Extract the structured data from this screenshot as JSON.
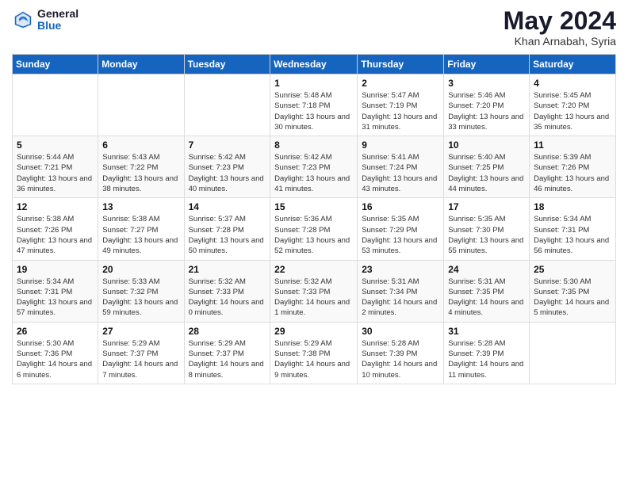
{
  "header": {
    "logo_general": "General",
    "logo_blue": "Blue",
    "title": "May 2024",
    "location": "Khan Arnabah, Syria"
  },
  "days_of_week": [
    "Sunday",
    "Monday",
    "Tuesday",
    "Wednesday",
    "Thursday",
    "Friday",
    "Saturday"
  ],
  "weeks": [
    [
      {
        "day": "",
        "info": ""
      },
      {
        "day": "",
        "info": ""
      },
      {
        "day": "",
        "info": ""
      },
      {
        "day": "1",
        "info": "Sunrise: 5:48 AM\nSunset: 7:18 PM\nDaylight: 13 hours\nand 30 minutes."
      },
      {
        "day": "2",
        "info": "Sunrise: 5:47 AM\nSunset: 7:19 PM\nDaylight: 13 hours\nand 31 minutes."
      },
      {
        "day": "3",
        "info": "Sunrise: 5:46 AM\nSunset: 7:20 PM\nDaylight: 13 hours\nand 33 minutes."
      },
      {
        "day": "4",
        "info": "Sunrise: 5:45 AM\nSunset: 7:20 PM\nDaylight: 13 hours\nand 35 minutes."
      }
    ],
    [
      {
        "day": "5",
        "info": "Sunrise: 5:44 AM\nSunset: 7:21 PM\nDaylight: 13 hours\nand 36 minutes."
      },
      {
        "day": "6",
        "info": "Sunrise: 5:43 AM\nSunset: 7:22 PM\nDaylight: 13 hours\nand 38 minutes."
      },
      {
        "day": "7",
        "info": "Sunrise: 5:42 AM\nSunset: 7:23 PM\nDaylight: 13 hours\nand 40 minutes."
      },
      {
        "day": "8",
        "info": "Sunrise: 5:42 AM\nSunset: 7:23 PM\nDaylight: 13 hours\nand 41 minutes."
      },
      {
        "day": "9",
        "info": "Sunrise: 5:41 AM\nSunset: 7:24 PM\nDaylight: 13 hours\nand 43 minutes."
      },
      {
        "day": "10",
        "info": "Sunrise: 5:40 AM\nSunset: 7:25 PM\nDaylight: 13 hours\nand 44 minutes."
      },
      {
        "day": "11",
        "info": "Sunrise: 5:39 AM\nSunset: 7:26 PM\nDaylight: 13 hours\nand 46 minutes."
      }
    ],
    [
      {
        "day": "12",
        "info": "Sunrise: 5:38 AM\nSunset: 7:26 PM\nDaylight: 13 hours\nand 47 minutes."
      },
      {
        "day": "13",
        "info": "Sunrise: 5:38 AM\nSunset: 7:27 PM\nDaylight: 13 hours\nand 49 minutes."
      },
      {
        "day": "14",
        "info": "Sunrise: 5:37 AM\nSunset: 7:28 PM\nDaylight: 13 hours\nand 50 minutes."
      },
      {
        "day": "15",
        "info": "Sunrise: 5:36 AM\nSunset: 7:28 PM\nDaylight: 13 hours\nand 52 minutes."
      },
      {
        "day": "16",
        "info": "Sunrise: 5:35 AM\nSunset: 7:29 PM\nDaylight: 13 hours\nand 53 minutes."
      },
      {
        "day": "17",
        "info": "Sunrise: 5:35 AM\nSunset: 7:30 PM\nDaylight: 13 hours\nand 55 minutes."
      },
      {
        "day": "18",
        "info": "Sunrise: 5:34 AM\nSunset: 7:31 PM\nDaylight: 13 hours\nand 56 minutes."
      }
    ],
    [
      {
        "day": "19",
        "info": "Sunrise: 5:34 AM\nSunset: 7:31 PM\nDaylight: 13 hours\nand 57 minutes."
      },
      {
        "day": "20",
        "info": "Sunrise: 5:33 AM\nSunset: 7:32 PM\nDaylight: 13 hours\nand 59 minutes."
      },
      {
        "day": "21",
        "info": "Sunrise: 5:32 AM\nSunset: 7:33 PM\nDaylight: 14 hours\nand 0 minutes."
      },
      {
        "day": "22",
        "info": "Sunrise: 5:32 AM\nSunset: 7:33 PM\nDaylight: 14 hours\nand 1 minute."
      },
      {
        "day": "23",
        "info": "Sunrise: 5:31 AM\nSunset: 7:34 PM\nDaylight: 14 hours\nand 2 minutes."
      },
      {
        "day": "24",
        "info": "Sunrise: 5:31 AM\nSunset: 7:35 PM\nDaylight: 14 hours\nand 4 minutes."
      },
      {
        "day": "25",
        "info": "Sunrise: 5:30 AM\nSunset: 7:35 PM\nDaylight: 14 hours\nand 5 minutes."
      }
    ],
    [
      {
        "day": "26",
        "info": "Sunrise: 5:30 AM\nSunset: 7:36 PM\nDaylight: 14 hours\nand 6 minutes."
      },
      {
        "day": "27",
        "info": "Sunrise: 5:29 AM\nSunset: 7:37 PM\nDaylight: 14 hours\nand 7 minutes."
      },
      {
        "day": "28",
        "info": "Sunrise: 5:29 AM\nSunset: 7:37 PM\nDaylight: 14 hours\nand 8 minutes."
      },
      {
        "day": "29",
        "info": "Sunrise: 5:29 AM\nSunset: 7:38 PM\nDaylight: 14 hours\nand 9 minutes."
      },
      {
        "day": "30",
        "info": "Sunrise: 5:28 AM\nSunset: 7:39 PM\nDaylight: 14 hours\nand 10 minutes."
      },
      {
        "day": "31",
        "info": "Sunrise: 5:28 AM\nSunset: 7:39 PM\nDaylight: 14 hours\nand 11 minutes."
      },
      {
        "day": "",
        "info": ""
      }
    ]
  ]
}
